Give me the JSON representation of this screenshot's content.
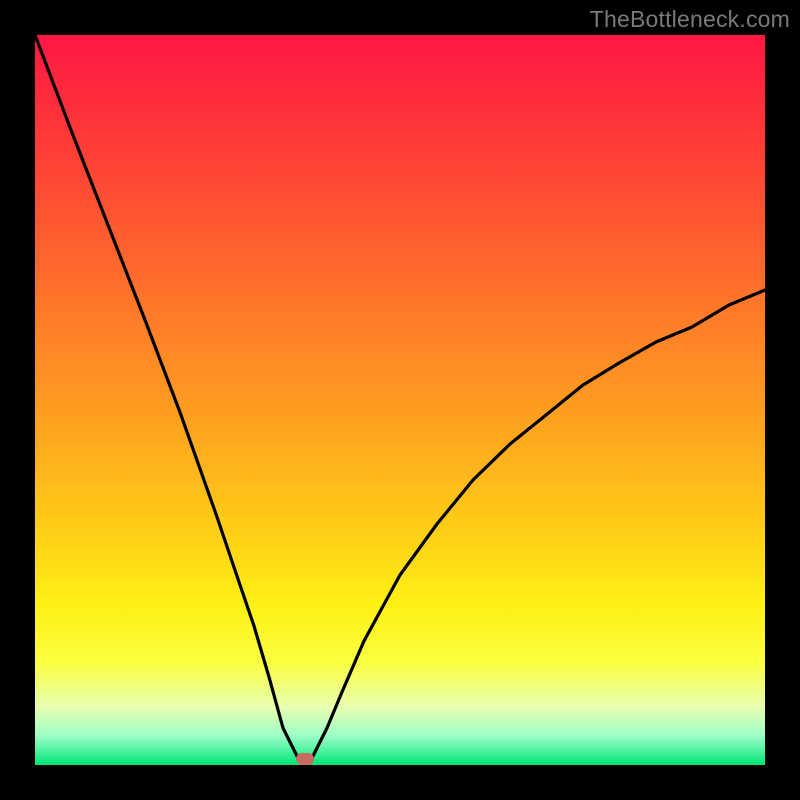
{
  "watermark": "TheBottleneck.com",
  "colors": {
    "background": "#000000",
    "curve": "#000000",
    "marker": "#c96a5f",
    "gradient_top": "#ff1744",
    "gradient_bottom": "#00e676"
  },
  "chart_data": {
    "type": "line",
    "title": "",
    "xlabel": "",
    "ylabel": "",
    "xlim": [
      0,
      100
    ],
    "ylim": [
      0,
      100
    ],
    "series": [
      {
        "name": "bottleneck-curve",
        "x": [
          0,
          5,
          10,
          15,
          20,
          25,
          28,
          30,
          32,
          34,
          36,
          37,
          38,
          40,
          42,
          45,
          50,
          55,
          60,
          65,
          70,
          75,
          80,
          85,
          90,
          95,
          100
        ],
        "y": [
          100,
          87,
          74,
          61,
          48,
          34,
          25,
          19,
          12,
          5,
          1,
          0,
          1,
          5,
          10,
          17,
          26,
          33,
          39,
          44,
          48,
          52,
          55,
          58,
          60,
          63,
          65
        ]
      }
    ],
    "annotations": [
      {
        "name": "optimal-marker",
        "x": 37,
        "y": 0
      }
    ]
  }
}
